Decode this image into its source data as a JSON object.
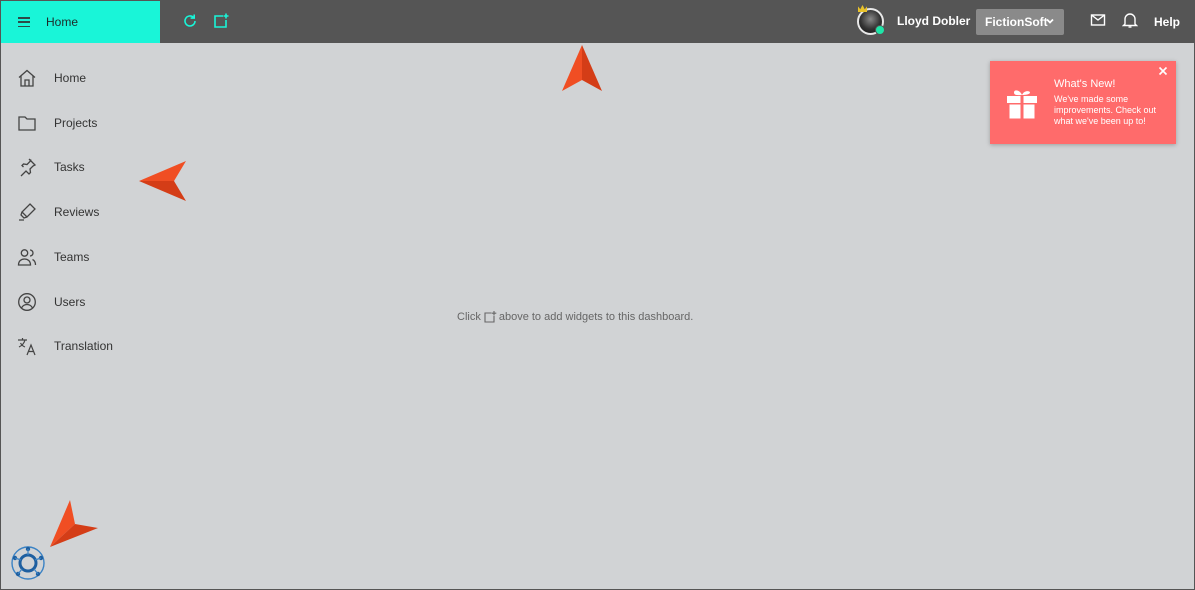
{
  "header": {
    "title": "Home",
    "user_name": "Lloyd Dobler",
    "org_select": "FictionSoft",
    "help_label": "Help"
  },
  "sidebar": {
    "items": [
      {
        "label": "Home",
        "icon": "home-icon"
      },
      {
        "label": "Projects",
        "icon": "folder-icon"
      },
      {
        "label": "Tasks",
        "icon": "pin-icon"
      },
      {
        "label": "Reviews",
        "icon": "highlighter-icon"
      },
      {
        "label": "Teams",
        "icon": "people-icon"
      },
      {
        "label": "Users",
        "icon": "user-circle-icon"
      },
      {
        "label": "Translation",
        "icon": "translate-icon"
      }
    ]
  },
  "main": {
    "empty_text_before": "Click",
    "empty_text_after": "above to add widgets to this dashboard."
  },
  "whats_new": {
    "title": "What's New!",
    "body": "We've made some improvements. Check out what we've been up to!"
  },
  "colors": {
    "accent": "#19f5d8",
    "topbar": "#555555",
    "background": "#d1d3d5",
    "notice": "#ff6b6b",
    "pointer": "#f04e23"
  }
}
